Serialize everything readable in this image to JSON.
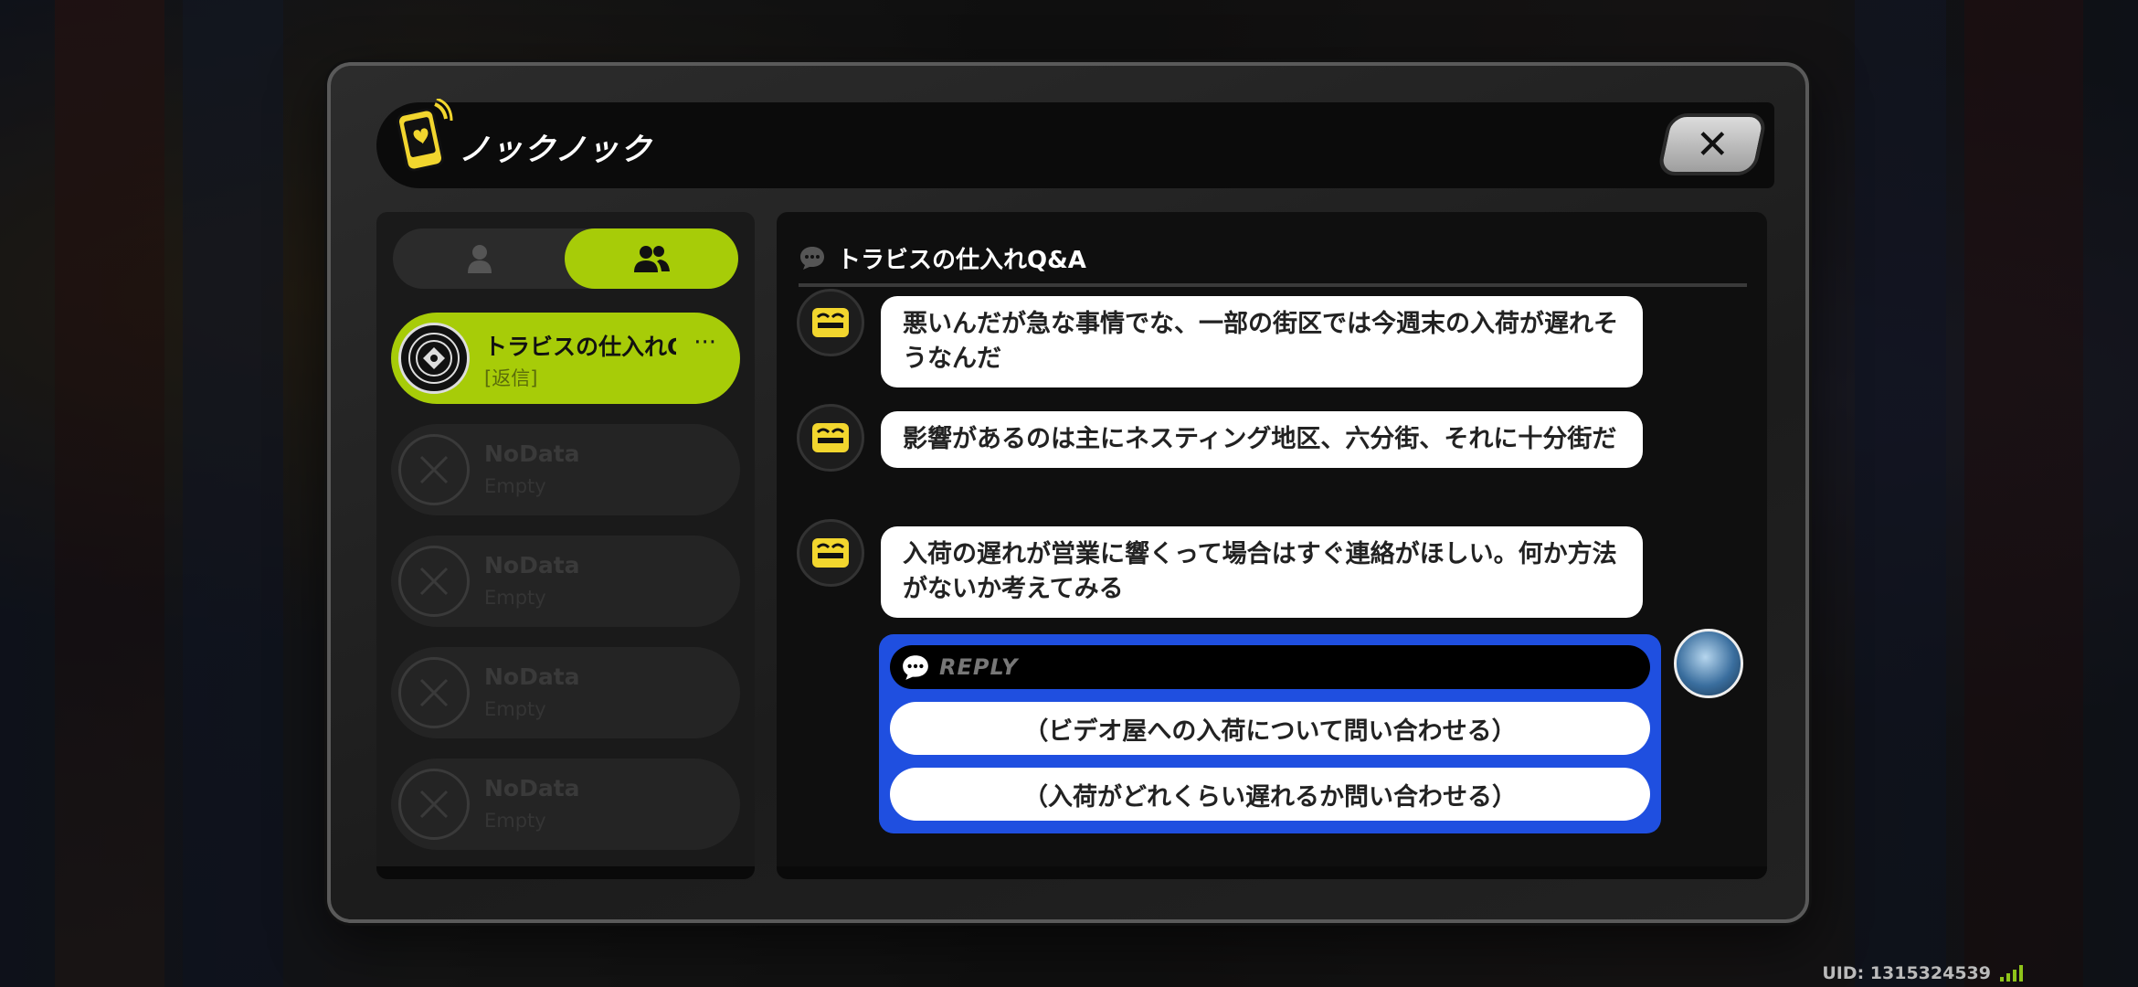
{
  "app": {
    "title": "ノックノック",
    "close_label": "✕"
  },
  "tabs": [
    {
      "name": "single",
      "icon": "person-icon",
      "selected": false
    },
    {
      "name": "group",
      "icon": "group-icon",
      "selected": true
    }
  ],
  "contacts": [
    {
      "name": "トラビスの仕入れQ",
      "sub": "[返信]",
      "more": "···",
      "active": true
    },
    {
      "name": "NoData",
      "sub": "Empty",
      "active": false
    },
    {
      "name": "NoData",
      "sub": "Empty",
      "active": false
    },
    {
      "name": "NoData",
      "sub": "Empty",
      "active": false
    },
    {
      "name": "NoData",
      "sub": "Empty",
      "active": false
    }
  ],
  "chat": {
    "title": "トラビスの仕入れQ&A",
    "messages": [
      {
        "text": "悪いんだが急な事情でな、一部の街区では今週末の入荷が遅れそうなんだ"
      },
      {
        "text": "影響があるのは主にネスティング地区、六分街、それに十分街だ"
      },
      {
        "text": "入荷の遅れが営業に響くって場合はすぐ連絡がほしい。何か方法がないか考えてみる"
      }
    ],
    "reply": {
      "label": "REPLY",
      "options": [
        "（ビデオ屋への入荷について問い合わせる）",
        "（入荷がどれくらい遅れるか問い合わせる）"
      ]
    }
  },
  "footer": {
    "uid": "UID: 1315324539"
  },
  "colors": {
    "accent": "#a7cc08",
    "reply_blue": "#1f4fe0",
    "icon_yellow": "#f2d62e"
  }
}
